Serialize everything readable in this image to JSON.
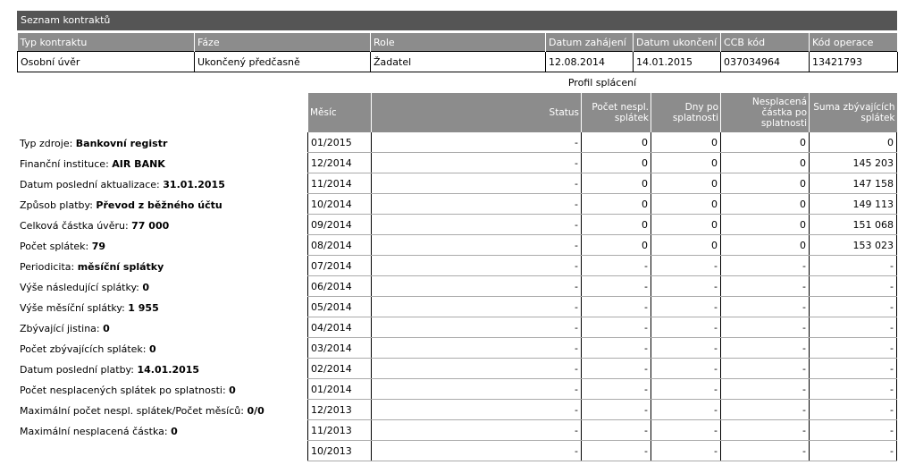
{
  "section_title": "Seznam kontraktů",
  "contract_headers": [
    "Typ kontraktu",
    "Fáze",
    "Role",
    "Datum zahájení",
    "Datum ukončení",
    "CCB kód",
    "Kód operace"
  ],
  "contract_row": [
    "Osobní úvěr",
    "Ukončený předčasně",
    "Žadatel",
    "12.08.2014",
    "14.01.2015",
    "037034964",
    "13421793"
  ],
  "profile": {
    "title": "Profil splácení",
    "headers": [
      "Měsíc",
      "Status",
      "Počet nespl. splátek",
      "Dny po splatnosti",
      "Nesplacená částka po splatnosti",
      "Suma zbývajících splátek"
    ],
    "rows": [
      [
        "01/2015",
        "-",
        "0",
        "0",
        "0",
        "0"
      ],
      [
        "12/2014",
        "-",
        "0",
        "0",
        "0",
        "145 203"
      ],
      [
        "11/2014",
        "-",
        "0",
        "0",
        "0",
        "147 158"
      ],
      [
        "10/2014",
        "-",
        "0",
        "0",
        "0",
        "149 113"
      ],
      [
        "09/2014",
        "-",
        "0",
        "0",
        "0",
        "151 068"
      ],
      [
        "08/2014",
        "-",
        "0",
        "0",
        "0",
        "153 023"
      ],
      [
        "07/2014",
        "-",
        "-",
        "-",
        "-",
        "-"
      ],
      [
        "06/2014",
        "-",
        "-",
        "-",
        "-",
        "-"
      ],
      [
        "05/2014",
        "-",
        "-",
        "-",
        "-",
        "-"
      ],
      [
        "04/2014",
        "-",
        "-",
        "-",
        "-",
        "-"
      ],
      [
        "03/2014",
        "-",
        "-",
        "-",
        "-",
        "-"
      ],
      [
        "02/2014",
        "-",
        "-",
        "-",
        "-",
        "-"
      ],
      [
        "01/2014",
        "-",
        "-",
        "-",
        "-",
        "-"
      ],
      [
        "12/2013",
        "-",
        "-",
        "-",
        "-",
        "-"
      ],
      [
        "11/2013",
        "-",
        "-",
        "-",
        "-",
        "-"
      ],
      [
        "10/2013",
        "-",
        "-",
        "-",
        "-",
        "-"
      ]
    ]
  },
  "info": [
    {
      "label": "Typ zdroje:",
      "value": "Bankovní registr"
    },
    {
      "label": "Finanční instituce:",
      "value": "AIR BANK"
    },
    {
      "label": "Datum poslední aktualizace:",
      "value": "31.01.2015"
    },
    {
      "label": "Způsob platby:",
      "value": "Převod z běžného účtu"
    },
    {
      "label": "Celková částka úvěru:",
      "value": "77 000"
    },
    {
      "label": "Počet splátek:",
      "value": "79"
    },
    {
      "label": "Periodicita:",
      "value": "měsíční splátky"
    },
    {
      "label": "Výše následující splátky:",
      "value": "0"
    },
    {
      "label": "Výše měsíční splátky:",
      "value": "1 955"
    },
    {
      "label": "Zbývající jistina:",
      "value": "0"
    },
    {
      "label": "Počet zbývajících splátek:",
      "value": "0"
    },
    {
      "label": "Datum poslední platby:",
      "value": "14.01.2015"
    },
    {
      "label": "Počet nesplacených splátek po splatnosti:",
      "value": "0"
    },
    {
      "label": "Maximální počet nespl. splátek/Počet měsíců:",
      "value": "0/0"
    },
    {
      "label": "Maximální nesplacená částka:",
      "value": "0"
    }
  ]
}
